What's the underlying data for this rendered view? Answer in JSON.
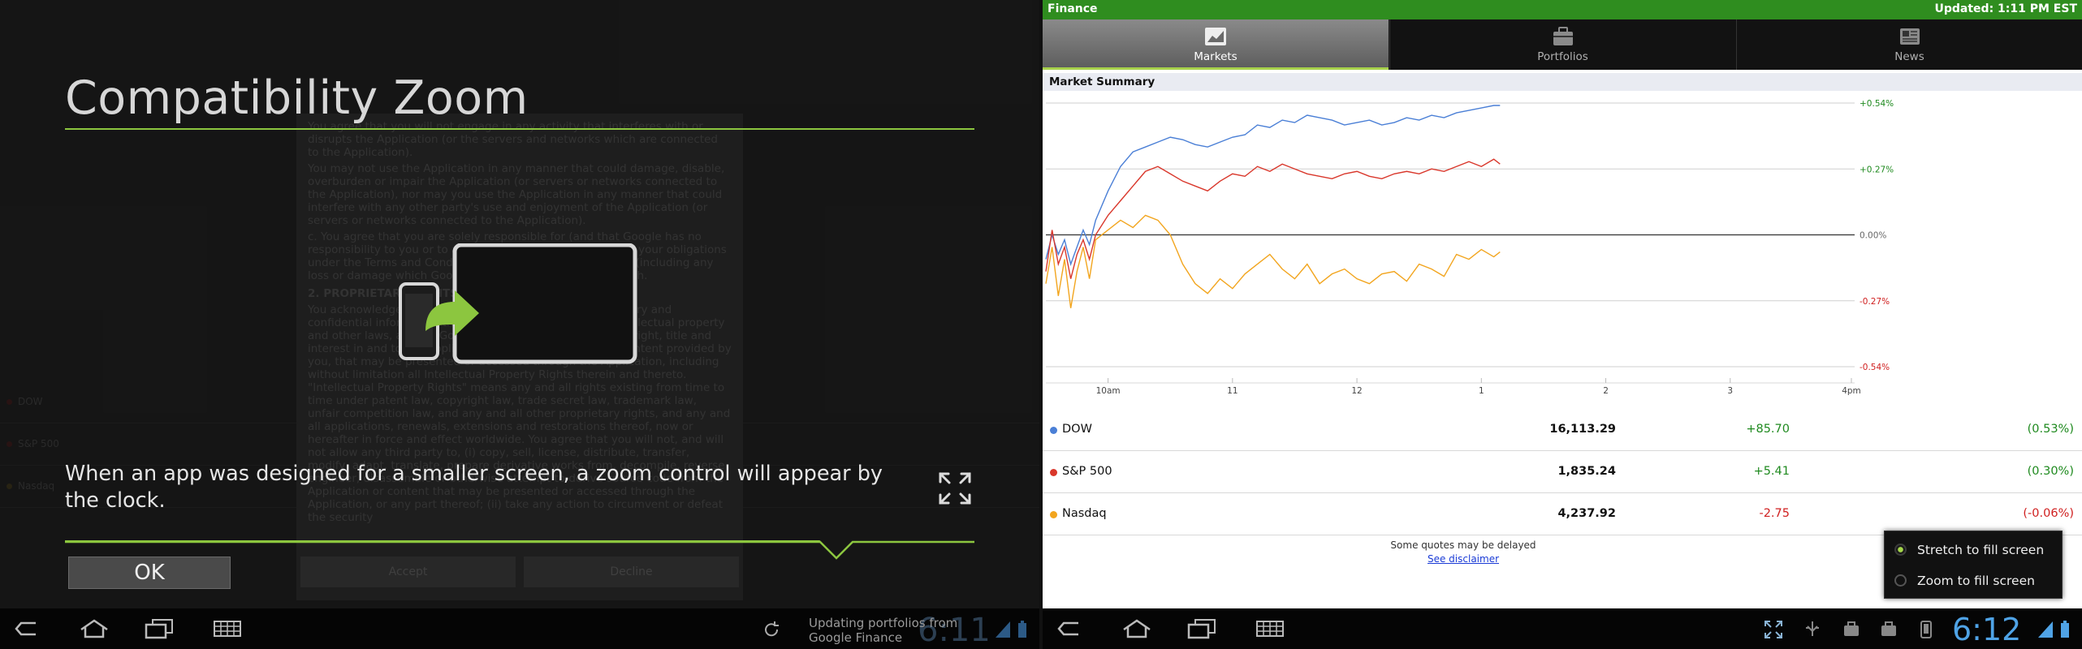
{
  "left": {
    "background_terms": {
      "paragraphs": [
        "You agree that you will not engage in any activity that interferes with or disrupts the Application (or the servers and networks which are connected to the Application).",
        "You may not use the Application in any manner that could damage, disable, overburden or impair the Application (or servers or networks connected to the Application), nor may you use the Application in any manner that could interfere with any other party's use and enjoyment of the Application (or servers or networks connected to the Application).",
        "c. You agree that you are solely responsible for (and that Google has no responsibility to you or to any third party for) any breach of your obligations under the Terms and Conditions, and for the consequences (including any loss or damage which Google may suffer) of any such breach."
      ],
      "section_title": "2. PROPRIETARY RIGHTS",
      "section_body": "You acknowledge that (a) the Application contains proprietary and confidential information that is protected by applicable intellectual property and other laws, and (b) Google and/or third parties own all right, title and interest in and to the Application and content, excluding content provided by you, that may be presented or accessed through the Application, including without limitation all Intellectual Property Rights therein and thereto. \"Intellectual Property Rights\" means any and all rights existing from time to time under patent law, copyright law, trade secret law, trademark law, unfair competition law, and any and all other proprietary rights, and any and all applications, renewals, extensions and restorations thereof, now or hereafter in force and effect worldwide. You agree that you will not, and will not allow any third party to, (i) copy, sell, license, distribute, transfer, modify, adapt, translate, prepare derivative works from, decompile, reverse engineer, disassemble or otherwise attempt to derive source code from the Application or content that may be presented or accessed through the Application, or any part thereof; (ii) take any action to circumvent or defeat the security",
      "accept_label": "Accept",
      "decline_label": "Decline",
      "ghost_rows": [
        "DOW",
        "S&P 500",
        "Nasdaq"
      ]
    },
    "dialog": {
      "title": "Compatibility Zoom",
      "description": "When an app was designed for a smaller screen, a zoom control will appear by the clock.",
      "ok_label": "OK"
    },
    "system_bar": {
      "status_text": "Updating portfolios from Google Finance",
      "clock": "6:11"
    }
  },
  "right": {
    "app_title": "Finance",
    "updated": "Updated: 1:11 PM EST",
    "tabs": [
      {
        "label": "Markets",
        "icon": "chart-icon",
        "active": true
      },
      {
        "label": "Portfolios",
        "icon": "briefcase-icon",
        "active": false
      },
      {
        "label": "News",
        "icon": "newspaper-icon",
        "active": false
      }
    ],
    "section_title": "Market Summary",
    "quotes": [
      {
        "name": "DOW",
        "value": "16,113.29",
        "change": "+85.70",
        "percent": "(0.53%)",
        "color": "#4a7fd6"
      },
      {
        "name": "S&P 500",
        "value": "1,835.24",
        "change": "+5.41",
        "percent": "(0.30%)",
        "color": "#d9372b"
      },
      {
        "name": "Nasdaq",
        "value": "4,237.92",
        "change": "-2.75",
        "percent": "(-0.06%)",
        "color": "#f2a51e"
      }
    ],
    "delay_note": "Some quotes may be delayed",
    "disclaimer": "See disclaimer",
    "fit_menu": {
      "options": [
        {
          "label": "Stretch to fill screen",
          "selected": true
        },
        {
          "label": "Zoom to fill screen",
          "selected": false
        }
      ]
    },
    "system_bar": {
      "clock": "6:12"
    }
  },
  "colors": {
    "accent": "#8cc63f",
    "finance_green": "#2f8d1f",
    "positive": "#1f8a1f",
    "negative": "#d02020",
    "clock_blue": "#4fa3e6"
  },
  "chart_data": {
    "type": "line",
    "title": "Market Summary",
    "x_ticks": [
      "10am",
      "11",
      "12",
      "1",
      "2",
      "3",
      "4pm"
    ],
    "y_ticks": [
      "+0.54%",
      "+0.27%",
      "0.00%",
      "-0.27%",
      "-0.54%"
    ],
    "ylim": [
      -0.54,
      0.54
    ],
    "x_unit": "hours since 9:30am",
    "xlim": [
      0,
      6.5
    ],
    "grid": true,
    "series": [
      {
        "name": "DOW",
        "color": "#4a7fd6",
        "x": [
          0,
          0.05,
          0.1,
          0.15,
          0.2,
          0.25,
          0.3,
          0.35,
          0.4,
          0.5,
          0.6,
          0.7,
          0.8,
          0.9,
          1.0,
          1.1,
          1.2,
          1.3,
          1.4,
          1.5,
          1.6,
          1.7,
          1.8,
          1.9,
          2.0,
          2.1,
          2.2,
          2.3,
          2.4,
          2.5,
          2.6,
          2.7,
          2.8,
          2.9,
          3.0,
          3.1,
          3.2,
          3.3,
          3.4,
          3.5,
          3.6,
          3.65
        ],
        "y": [
          -0.1,
          0.0,
          -0.08,
          -0.02,
          -0.12,
          -0.05,
          0.02,
          -0.04,
          0.06,
          0.18,
          0.28,
          0.34,
          0.36,
          0.38,
          0.4,
          0.39,
          0.37,
          0.36,
          0.38,
          0.4,
          0.41,
          0.45,
          0.44,
          0.47,
          0.46,
          0.49,
          0.48,
          0.47,
          0.45,
          0.46,
          0.47,
          0.45,
          0.46,
          0.48,
          0.47,
          0.49,
          0.48,
          0.5,
          0.51,
          0.52,
          0.53,
          0.53
        ]
      },
      {
        "name": "S&P 500",
        "color": "#d9372b",
        "x": [
          0,
          0.05,
          0.1,
          0.15,
          0.2,
          0.25,
          0.3,
          0.35,
          0.4,
          0.5,
          0.6,
          0.7,
          0.8,
          0.9,
          1.0,
          1.1,
          1.2,
          1.3,
          1.4,
          1.5,
          1.6,
          1.7,
          1.8,
          1.9,
          2.0,
          2.1,
          2.2,
          2.3,
          2.4,
          2.5,
          2.6,
          2.7,
          2.8,
          2.9,
          3.0,
          3.1,
          3.2,
          3.3,
          3.4,
          3.5,
          3.6,
          3.65
        ],
        "y": [
          -0.15,
          0.02,
          -0.12,
          -0.05,
          -0.18,
          -0.08,
          -0.02,
          -0.1,
          0.0,
          0.08,
          0.14,
          0.2,
          0.26,
          0.28,
          0.25,
          0.22,
          0.2,
          0.18,
          0.22,
          0.25,
          0.24,
          0.28,
          0.26,
          0.29,
          0.27,
          0.25,
          0.24,
          0.23,
          0.25,
          0.26,
          0.24,
          0.23,
          0.25,
          0.26,
          0.25,
          0.27,
          0.26,
          0.28,
          0.3,
          0.28,
          0.31,
          0.29
        ]
      },
      {
        "name": "Nasdaq",
        "color": "#f2a51e",
        "x": [
          0,
          0.05,
          0.1,
          0.15,
          0.2,
          0.25,
          0.3,
          0.35,
          0.4,
          0.5,
          0.6,
          0.7,
          0.8,
          0.9,
          1.0,
          1.1,
          1.2,
          1.3,
          1.4,
          1.5,
          1.6,
          1.7,
          1.8,
          1.9,
          2.0,
          2.1,
          2.2,
          2.3,
          2.4,
          2.5,
          2.6,
          2.7,
          2.8,
          2.9,
          3.0,
          3.1,
          3.2,
          3.3,
          3.4,
          3.5,
          3.6,
          3.65
        ],
        "y": [
          -0.2,
          -0.05,
          -0.25,
          -0.1,
          -0.3,
          -0.15,
          -0.05,
          -0.18,
          -0.02,
          0.02,
          0.06,
          0.03,
          0.08,
          0.06,
          0.0,
          -0.12,
          -0.2,
          -0.24,
          -0.18,
          -0.22,
          -0.16,
          -0.12,
          -0.08,
          -0.14,
          -0.18,
          -0.12,
          -0.2,
          -0.16,
          -0.14,
          -0.18,
          -0.2,
          -0.16,
          -0.15,
          -0.19,
          -0.12,
          -0.14,
          -0.17,
          -0.08,
          -0.1,
          -0.06,
          -0.09,
          -0.07
        ]
      }
    ]
  }
}
